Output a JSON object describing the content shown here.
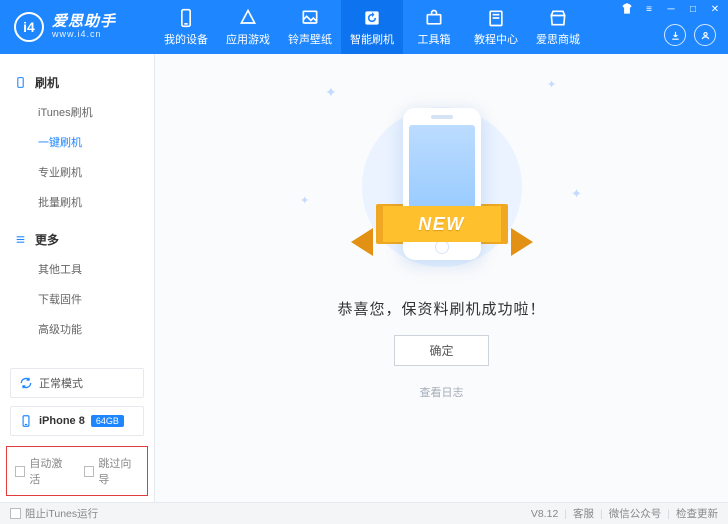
{
  "brand": {
    "name": "爱思助手",
    "url": "www.i4.cn",
    "logo_text": "i4"
  },
  "nav": [
    {
      "label": "我的设备"
    },
    {
      "label": "应用游戏"
    },
    {
      "label": "铃声壁纸"
    },
    {
      "label": "智能刷机",
      "active": true
    },
    {
      "label": "工具箱"
    },
    {
      "label": "教程中心"
    },
    {
      "label": "爱思商城"
    }
  ],
  "sidebar": {
    "groups": [
      {
        "title": "刷机",
        "items": [
          {
            "label": "iTunes刷机"
          },
          {
            "label": "一键刷机",
            "active": true
          },
          {
            "label": "专业刷机"
          },
          {
            "label": "批量刷机"
          }
        ]
      },
      {
        "title": "更多",
        "items": [
          {
            "label": "其他工具"
          },
          {
            "label": "下载固件"
          },
          {
            "label": "高级功能"
          }
        ]
      }
    ],
    "mode": "正常模式",
    "device": {
      "name": "iPhone 8",
      "storage": "64GB"
    },
    "options": {
      "auto_activate": "自动激活",
      "skip_guide": "跳过向导"
    }
  },
  "main": {
    "ribbon": "NEW",
    "message": "恭喜您，保资料刷机成功啦！",
    "ok": "确定",
    "log_link": "查看日志"
  },
  "footer": {
    "block_itunes": "阻止iTunes运行",
    "version": "V8.12",
    "support": "客服",
    "wechat": "微信公众号",
    "update": "检查更新"
  }
}
